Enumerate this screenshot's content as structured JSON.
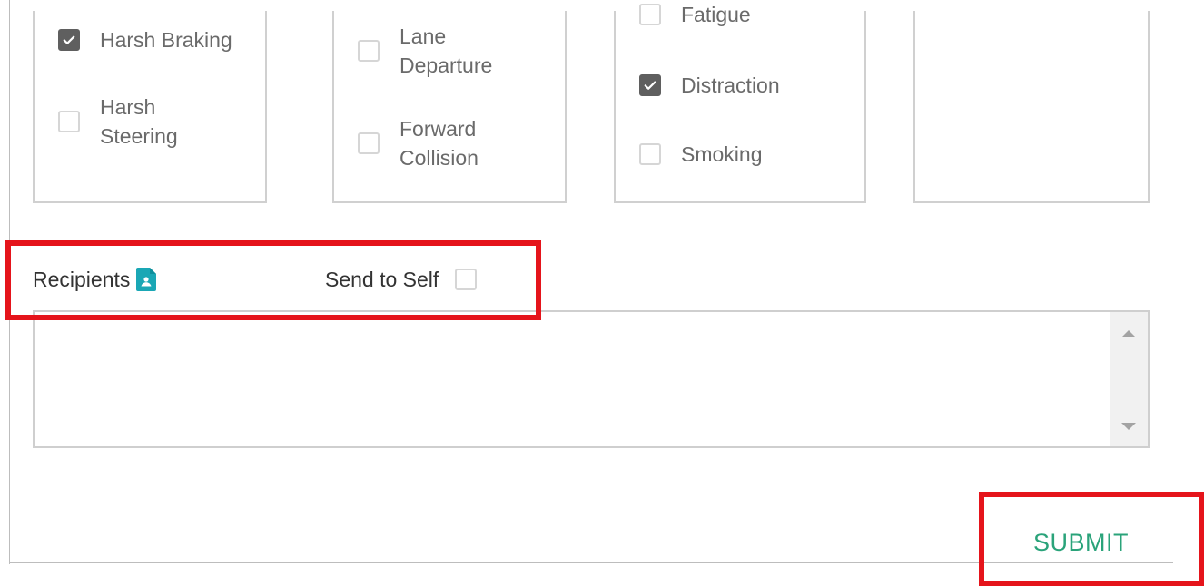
{
  "alert_types": {
    "column1": [
      {
        "label": "Harsh Braking",
        "checked": true
      },
      {
        "label": "Harsh\nSteering",
        "checked": false
      }
    ],
    "column2": [
      {
        "label": "Lane\nDeparture",
        "checked": false
      },
      {
        "label": "Forward\nCollision",
        "checked": false
      }
    ],
    "column3": [
      {
        "label": "Fatigue",
        "checked": false
      },
      {
        "label": "Distraction",
        "checked": true
      },
      {
        "label": "Smoking",
        "checked": false
      }
    ]
  },
  "recipients": {
    "label": "Recipients",
    "icon": "contact-document-icon",
    "send_to_self_label": "Send to Self",
    "send_to_self_checked": false,
    "value": ""
  },
  "actions": {
    "submit_label": "SUBMIT"
  },
  "colors": {
    "accent": "#2aa37a",
    "icon_teal": "#1aa7b5",
    "highlight": "#e5141b",
    "checkbox_checked": "#5f5f5f"
  }
}
